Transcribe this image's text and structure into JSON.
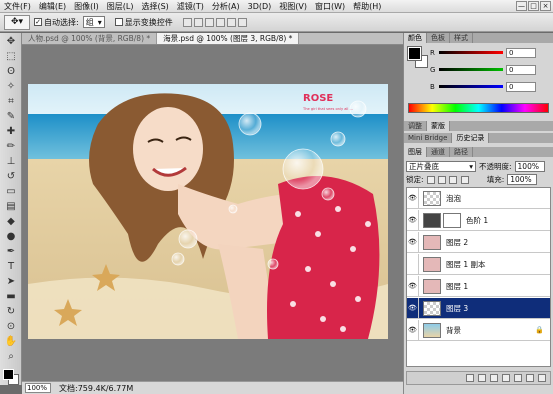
{
  "menubar": {
    "items": [
      "文件(F)",
      "编辑(E)",
      "图像(I)",
      "图层(L)",
      "选择(S)",
      "滤镜(T)",
      "分析(A)",
      "3D(D)",
      "视图(V)",
      "窗口(W)",
      "帮助(H)"
    ],
    "window_buttons": [
      "—",
      "□",
      "×"
    ]
  },
  "options": {
    "auto_select_label": "自动选择:",
    "auto_select_value": "组",
    "show_transform_label": "显示变换控件"
  },
  "doc_tabs": [
    "人物.psd @ 100% (背景, RGB/8) *",
    "海景.psd @ 100% (图层 3, RGB/8) *"
  ],
  "photo": {
    "brand": "ROSE",
    "tagline": "The girl that sees only all ..."
  },
  "status": {
    "zoom": "100%",
    "doc_info": "文档:759.4K/6.77M"
  },
  "color_panel": {
    "tabs": [
      "颜色",
      "色板",
      "样式"
    ],
    "rows": [
      {
        "label": "R",
        "value": "0",
        "color": "#d22020"
      },
      {
        "label": "G",
        "value": "0",
        "color": "#20a020"
      },
      {
        "label": "B",
        "value": "0",
        "color": "#2020d0"
      }
    ]
  },
  "adj_panel": {
    "tabs": [
      "调整",
      "蒙版"
    ]
  },
  "hist_panel": {
    "tabs": [
      "Mini Bridge",
      "历史记录"
    ]
  },
  "layers_panel": {
    "tabs": [
      "图层",
      "通道",
      "路径"
    ],
    "blend_mode": "正片叠底",
    "opacity_label": "不透明度:",
    "opacity_value": "100%",
    "lock_label": "锁定:",
    "fill_label": "填充:",
    "fill_value": "100%",
    "layers": [
      {
        "name": "泡泡",
        "visible": true,
        "selected": false,
        "locked": false
      },
      {
        "name": "色阶 1",
        "visible": true,
        "selected": false,
        "locked": false
      },
      {
        "name": "图层 2",
        "visible": true,
        "selected": false,
        "locked": false
      },
      {
        "name": "图层 1 副本",
        "visible": false,
        "selected": false,
        "locked": false
      },
      {
        "name": "图层 1",
        "visible": true,
        "selected": false,
        "locked": false
      },
      {
        "name": "图层 3",
        "visible": true,
        "selected": true,
        "locked": false
      },
      {
        "name": "背景",
        "visible": true,
        "selected": false,
        "locked": true
      }
    ]
  }
}
